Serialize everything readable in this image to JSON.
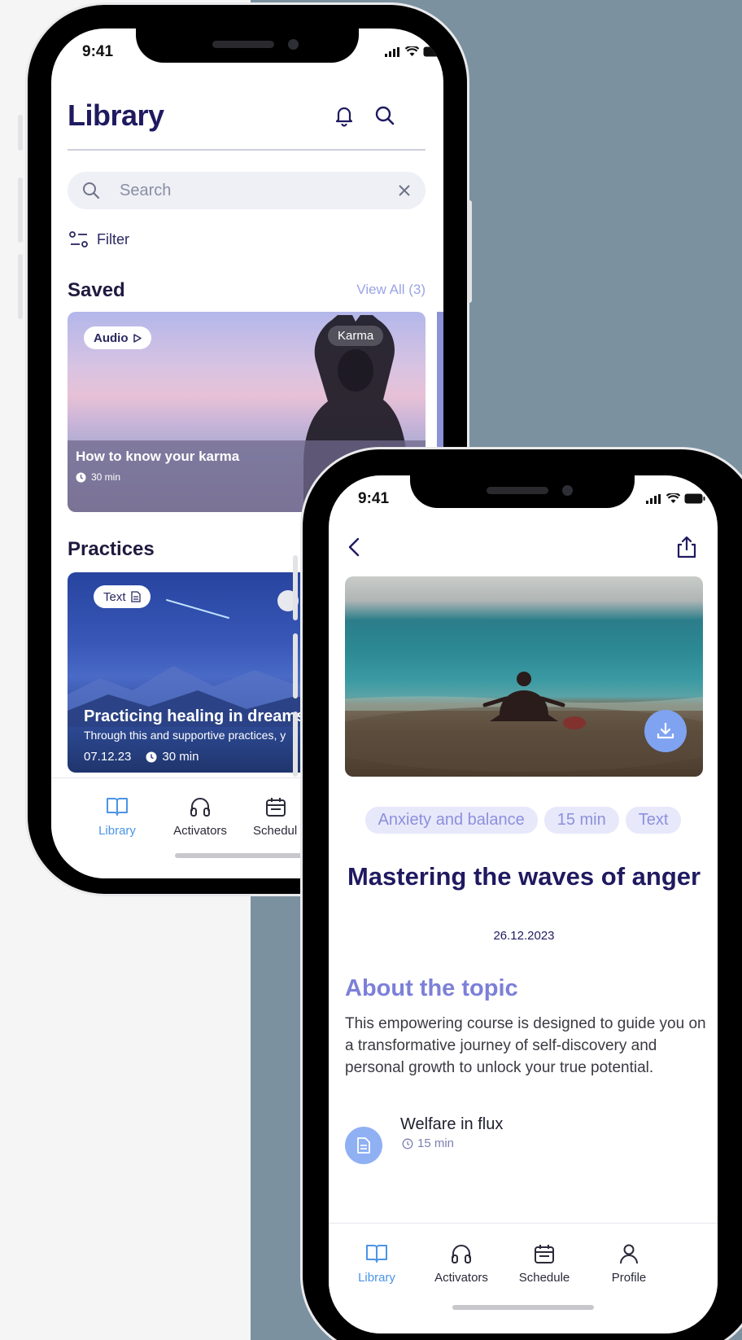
{
  "colors": {
    "accent": "#4a94e6",
    "title": "#1f1a60",
    "muted_purple": "#7c80d8",
    "tag_bg": "#e7e8fa",
    "right_bg": "#7b919f"
  },
  "phone_library": {
    "status": {
      "time": "9:41"
    },
    "header": {
      "title": "Library",
      "icons": [
        "bell-icon",
        "search-icon"
      ]
    },
    "search": {
      "placeholder": "Search"
    },
    "filter_label": "Filter",
    "saved": {
      "title": "Saved",
      "view_all": "View All (3)",
      "card": {
        "type_badge": "Audio",
        "tag": "Karma",
        "title": "How to know your karma",
        "duration": "30 min"
      }
    },
    "practices": {
      "title": "Practices",
      "card": {
        "type_badge": "Text",
        "title": "Practicing healing in dreams",
        "subtitle": "Through this and supportive practices, y",
        "date": "07.12.23",
        "duration": "30 min"
      }
    },
    "tabs": [
      {
        "label": "Library",
        "icon": "book-icon",
        "active": true
      },
      {
        "label": "Activators",
        "icon": "headphones-icon",
        "active": false
      },
      {
        "label": "Schedul",
        "icon": "calendar-icon",
        "active": false
      }
    ]
  },
  "phone_detail": {
    "status": {
      "time": "9:41"
    },
    "tags": [
      "Anxiety and balance",
      "15 min",
      "Text"
    ],
    "title": "Mastering the waves of anger",
    "date": "26.12.2023",
    "about": {
      "title": "About the topic",
      "text": "This empowering course is designed to guide you on a transformative journey of self-discovery and personal growth to unlock your true potential."
    },
    "related": {
      "title": "Welfare in flux",
      "duration": "15 min",
      "icon": "document-icon"
    },
    "tabs": [
      {
        "label": "Library",
        "icon": "book-icon",
        "active": true
      },
      {
        "label": "Activators",
        "icon": "headphones-icon",
        "active": false
      },
      {
        "label": "Schedule",
        "icon": "calendar-icon",
        "active": false
      },
      {
        "label": "Profile",
        "icon": "user-icon",
        "active": false
      }
    ]
  }
}
